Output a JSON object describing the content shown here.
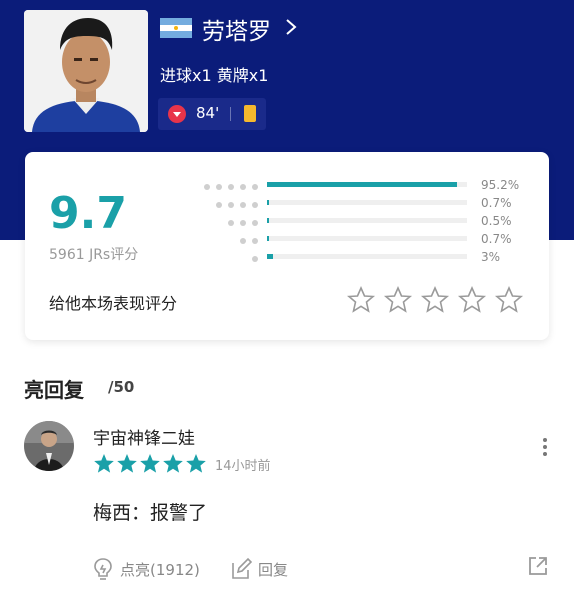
{
  "player": {
    "name": "劳塔罗",
    "stats": "进球x1 黄牌x1",
    "sub_minute": "84'"
  },
  "rating": {
    "score": "9.7",
    "raters": "5961 JRs评分",
    "distribution": [
      {
        "stars": 5,
        "percent": 95.2,
        "label": "95.2%"
      },
      {
        "stars": 4,
        "percent": 0.7,
        "label": "0.7%"
      },
      {
        "stars": 3,
        "percent": 0.5,
        "label": "0.5%"
      },
      {
        "stars": 2,
        "percent": 0.7,
        "label": "0.7%"
      },
      {
        "stars": 1,
        "percent": 3,
        "label": "3%"
      }
    ],
    "rate_prompt": "给他本场表现评分"
  },
  "replies": {
    "title": "亮回复",
    "count": "/50"
  },
  "comment": {
    "user": "宇宙神锋二娃",
    "stars": 5,
    "time": "14小时前",
    "text": "梅西：报警了",
    "light_label": "点亮(1912)",
    "reply_label": "回复"
  },
  "colors": {
    "header_bg": "#0b1c7a",
    "accent": "#1aa0a8",
    "yellow_card": "#f5b82e",
    "sub_red": "#e8344a"
  }
}
